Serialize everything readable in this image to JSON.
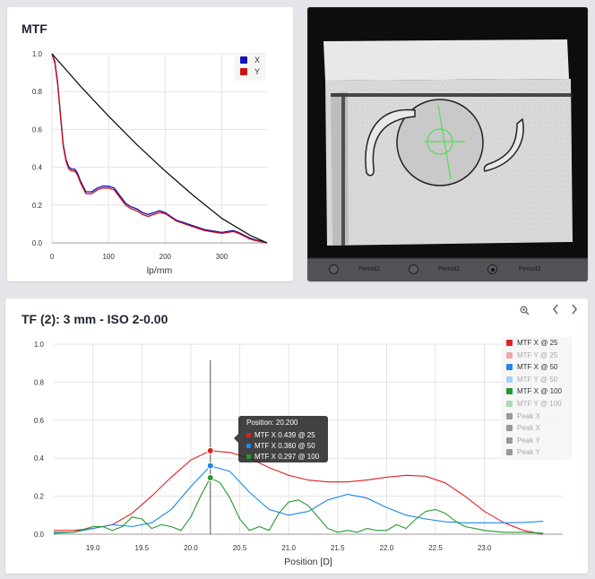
{
  "mtf_panel": {
    "title": "MTF",
    "xlabel": "lp/mm",
    "legend": [
      {
        "label": "X",
        "color": "#1111bb"
      },
      {
        "label": "Y",
        "color": "#cc1111"
      }
    ]
  },
  "image_panel": {
    "periods": [
      {
        "label": "Period1",
        "checked": false
      },
      {
        "label": "Period2",
        "checked": false
      },
      {
        "label": "Period3",
        "checked": true
      }
    ]
  },
  "tf_panel": {
    "title": "TF (2): 3 mm - ISO 2-0.00",
    "xlabel": "Position [D]",
    "toolbar": {
      "zoom_icon": "zoom-icon",
      "prev_icon": "chevron-left-icon",
      "next_icon": "chevron-right-icon"
    },
    "tooltip": {
      "header": "Position: 20.200",
      "lines": [
        {
          "text": "MTF X 0.439 @ 25",
          "color": "#dd2222"
        },
        {
          "text": "MTF X 0.360 @ 50",
          "color": "#1e88e5"
        },
        {
          "text": "MTF X 0.297 @ 100",
          "color": "#229933"
        }
      ]
    },
    "legend": [
      {
        "label": "MTF X @ 25",
        "color": "#dd2222",
        "active": true
      },
      {
        "label": "MTF Y @ 25",
        "color": "#eea9a9",
        "active": false
      },
      {
        "label": "MTF X @ 50",
        "color": "#1e88e5",
        "active": true
      },
      {
        "label": "MTF Y @ 50",
        "color": "#a9cff3",
        "active": false
      },
      {
        "label": "MTF X @ 100",
        "color": "#229933",
        "active": true
      },
      {
        "label": "MTF Y @ 100",
        "color": "#a9dcb2",
        "active": false
      },
      {
        "label": "Peak X",
        "color": "#999999",
        "active": false
      },
      {
        "label": "Peak X",
        "color": "#999999",
        "active": false
      },
      {
        "label": "Peak Y",
        "color": "#999999",
        "active": false
      },
      {
        "label": "Peak Y",
        "color": "#999999",
        "active": false
      }
    ]
  },
  "chart_data": [
    {
      "type": "line",
      "title": "MTF",
      "xlabel": "lp/mm",
      "ylabel": "",
      "xlim": [
        0,
        380
      ],
      "ylim": [
        0,
        1.0
      ],
      "xticks": [
        0,
        100,
        200,
        300
      ],
      "yticks": [
        0.0,
        0.2,
        0.4,
        0.6,
        0.8,
        1.0
      ],
      "legend_position": "top-right",
      "series": [
        {
          "name": "X",
          "color": "#1111bb",
          "x": [
            0,
            5,
            10,
            15,
            20,
            25,
            30,
            35,
            40,
            45,
            50,
            60,
            70,
            80,
            90,
            100,
            110,
            120,
            130,
            140,
            150,
            160,
            170,
            180,
            190,
            200,
            210,
            220,
            230,
            240,
            250,
            260,
            270,
            280,
            290,
            300,
            310,
            320,
            330,
            340,
            350,
            360,
            370,
            380
          ],
          "y": [
            1.0,
            0.96,
            0.85,
            0.68,
            0.52,
            0.44,
            0.4,
            0.39,
            0.39,
            0.37,
            0.33,
            0.27,
            0.27,
            0.29,
            0.3,
            0.3,
            0.29,
            0.25,
            0.21,
            0.19,
            0.18,
            0.16,
            0.15,
            0.16,
            0.17,
            0.16,
            0.14,
            0.12,
            0.11,
            0.1,
            0.09,
            0.08,
            0.07,
            0.065,
            0.06,
            0.055,
            0.06,
            0.065,
            0.055,
            0.04,
            0.025,
            0.015,
            0.008,
            0.0
          ]
        },
        {
          "name": "Y",
          "color": "#cc1111",
          "x": [
            0,
            5,
            10,
            15,
            20,
            25,
            30,
            35,
            40,
            45,
            50,
            60,
            70,
            80,
            90,
            100,
            110,
            120,
            130,
            140,
            150,
            160,
            170,
            180,
            190,
            200,
            210,
            220,
            230,
            240,
            250,
            260,
            270,
            280,
            290,
            300,
            310,
            320,
            330,
            340,
            350,
            360,
            370,
            380
          ],
          "y": [
            1.0,
            0.95,
            0.84,
            0.67,
            0.51,
            0.43,
            0.39,
            0.38,
            0.38,
            0.36,
            0.32,
            0.26,
            0.26,
            0.28,
            0.29,
            0.29,
            0.28,
            0.24,
            0.2,
            0.18,
            0.17,
            0.15,
            0.14,
            0.15,
            0.16,
            0.155,
            0.135,
            0.115,
            0.105,
            0.095,
            0.085,
            0.075,
            0.065,
            0.06,
            0.055,
            0.05,
            0.055,
            0.06,
            0.05,
            0.035,
            0.02,
            0.012,
            0.006,
            0.0
          ]
        },
        {
          "name": "",
          "color": "#111111",
          "x": [
            0,
            50,
            100,
            150,
            200,
            250,
            300,
            350,
            380
          ],
          "y": [
            1.0,
            0.83,
            0.67,
            0.52,
            0.38,
            0.25,
            0.13,
            0.04,
            0.0
          ]
        }
      ]
    },
    {
      "type": "line",
      "title": "TF (2): 3 mm - ISO 2-0.00",
      "xlabel": "Position [D]",
      "ylabel": "",
      "xlim": [
        18.6,
        23.8
      ],
      "ylim": [
        0,
        1.0
      ],
      "xticks": [
        19.0,
        19.5,
        20.0,
        20.5,
        21.0,
        21.5,
        22.0,
        22.5,
        23.0
      ],
      "yticks": [
        0.0,
        0.2,
        0.4,
        0.6,
        0.8,
        1.0
      ],
      "legend_position": "top-right",
      "cursor_x": 20.2,
      "series": [
        {
          "name": "MTF X @ 25",
          "color": "#dd2222",
          "x": [
            18.6,
            18.8,
            19.0,
            19.2,
            19.4,
            19.6,
            19.8,
            20.0,
            20.2,
            20.4,
            20.6,
            20.8,
            21.0,
            21.2,
            21.4,
            21.6,
            21.8,
            22.0,
            22.2,
            22.4,
            22.6,
            22.8,
            23.0,
            23.2,
            23.4,
            23.6
          ],
          "y": [
            0.02,
            0.02,
            0.03,
            0.05,
            0.11,
            0.2,
            0.3,
            0.39,
            0.439,
            0.43,
            0.4,
            0.35,
            0.31,
            0.285,
            0.275,
            0.275,
            0.285,
            0.3,
            0.31,
            0.305,
            0.27,
            0.2,
            0.12,
            0.06,
            0.02,
            0.0
          ]
        },
        {
          "name": "MTF X @ 50",
          "color": "#1e88e5",
          "x": [
            18.6,
            18.8,
            19.0,
            19.2,
            19.4,
            19.6,
            19.8,
            20.0,
            20.2,
            20.4,
            20.6,
            20.8,
            21.0,
            21.2,
            21.4,
            21.6,
            21.8,
            22.0,
            22.2,
            22.4,
            22.6,
            22.8,
            23.0,
            23.2,
            23.4,
            23.6
          ],
          "y": [
            0.01,
            0.01,
            0.03,
            0.05,
            0.04,
            0.06,
            0.13,
            0.25,
            0.36,
            0.33,
            0.22,
            0.13,
            0.1,
            0.12,
            0.18,
            0.21,
            0.19,
            0.14,
            0.1,
            0.08,
            0.065,
            0.06,
            0.06,
            0.06,
            0.062,
            0.068
          ]
        },
        {
          "name": "MTF X @ 100",
          "color": "#229933",
          "x": [
            18.6,
            18.8,
            19.0,
            19.1,
            19.2,
            19.3,
            19.4,
            19.5,
            19.6,
            19.7,
            19.8,
            19.9,
            20.0,
            20.1,
            20.2,
            20.3,
            20.4,
            20.5,
            20.6,
            20.7,
            20.8,
            20.9,
            21.0,
            21.1,
            21.2,
            21.3,
            21.4,
            21.5,
            21.6,
            21.7,
            21.8,
            21.9,
            22.0,
            22.1,
            22.2,
            22.3,
            22.4,
            22.5,
            22.6,
            22.7,
            22.8,
            22.9,
            23.0,
            23.2,
            23.4,
            23.6
          ],
          "y": [
            0.005,
            0.01,
            0.04,
            0.04,
            0.02,
            0.04,
            0.09,
            0.08,
            0.03,
            0.05,
            0.04,
            0.02,
            0.09,
            0.2,
            0.297,
            0.27,
            0.19,
            0.08,
            0.02,
            0.04,
            0.02,
            0.11,
            0.17,
            0.18,
            0.15,
            0.09,
            0.03,
            0.01,
            0.02,
            0.01,
            0.03,
            0.02,
            0.02,
            0.05,
            0.03,
            0.08,
            0.12,
            0.13,
            0.11,
            0.07,
            0.04,
            0.03,
            0.02,
            0.01,
            0.01,
            0.005
          ]
        }
      ]
    }
  ]
}
